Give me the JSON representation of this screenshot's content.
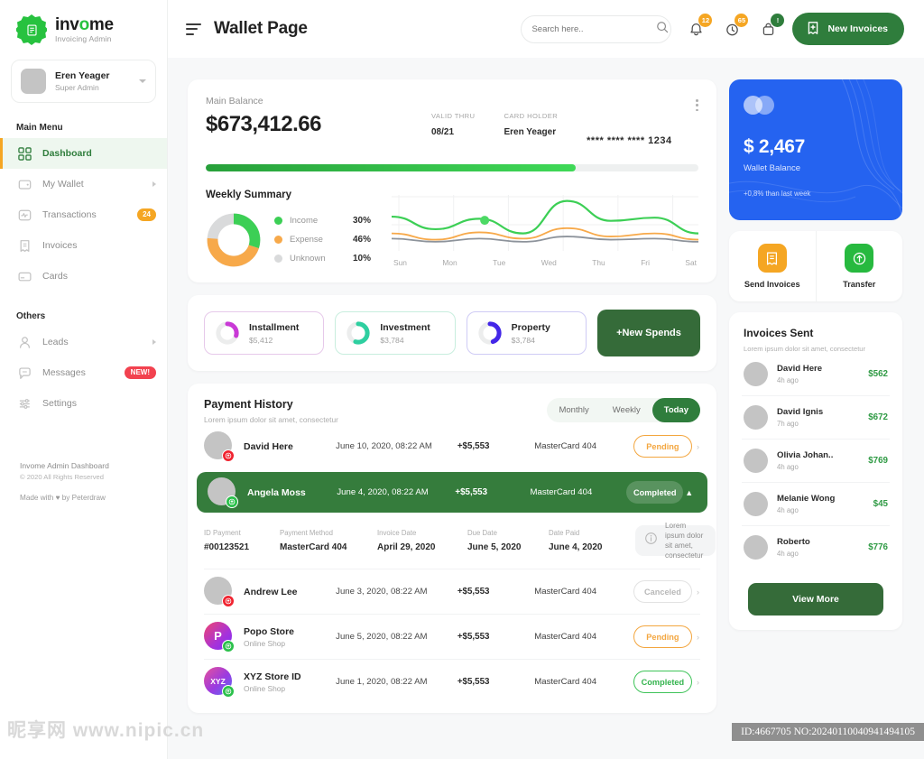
{
  "brand": {
    "name_pre": "inv",
    "name_mid": "o",
    "name_post": "me",
    "full": "invome",
    "subtitle": "Invoicing Admin"
  },
  "user": {
    "name": "Eren Yeager",
    "role": "Super Admin"
  },
  "sidebar": {
    "main_label": "Main Menu",
    "others_label": "Others",
    "main_items": [
      {
        "label": "Dashboard",
        "icon": "grid-icon",
        "badge": "",
        "arrow": false
      },
      {
        "label": "My Wallet",
        "icon": "wallet-icon",
        "badge": "",
        "arrow": true
      },
      {
        "label": "Transactions",
        "icon": "activity-icon",
        "badge": "24",
        "arrow": false
      },
      {
        "label": "Invoices",
        "icon": "invoice-icon",
        "badge": "",
        "arrow": false
      },
      {
        "label": "Cards",
        "icon": "card-icon",
        "badge": "",
        "arrow": false
      }
    ],
    "other_items": [
      {
        "label": "Leads",
        "icon": "user-icon",
        "badge": "",
        "arrow": true
      },
      {
        "label": "Messages",
        "icon": "chat-icon",
        "badge": "NEW!",
        "arrow": false
      },
      {
        "label": "Settings",
        "icon": "sliders-icon",
        "badge": "",
        "arrow": false
      }
    ],
    "footer": {
      "line1": "Invome Admin Dashboard",
      "line2": "© 2020 All Rights Reserved",
      "line3": "Made with ♥ by Peterdraw"
    }
  },
  "topbar": {
    "title": "Wallet Page",
    "search_placeholder": "Search here..",
    "notifications": [
      {
        "icon": "bell-icon",
        "count": "12",
        "color": "#f5a623"
      },
      {
        "icon": "clock-icon",
        "count": "65",
        "color": "#f5a623"
      },
      {
        "icon": "bag-icon",
        "count": "!",
        "color": "#2f7d3c"
      }
    ],
    "new_invoice_label": "New Invoices"
  },
  "balance": {
    "label": "Main Balance",
    "amount": "$673,412.66",
    "valid_thru_label": "VALID THRU",
    "valid_thru": "08/21",
    "card_holder_label": "CARD HOLDER",
    "card_holder": "Eren Yeager",
    "card_number": "**** **** **** 1234",
    "progress_percent": 75
  },
  "weekly": {
    "title": "Weekly Summary",
    "legend": [
      {
        "name": "Income",
        "value": "30%",
        "color": "#3ccf55"
      },
      {
        "name": "Expense",
        "value": "46%",
        "color": "#f7a94a"
      },
      {
        "name": "Unknown",
        "value": "10%",
        "color": "#d9dadb"
      }
    ]
  },
  "chart_data": {
    "type": "line",
    "title": "Weekly Summary",
    "x": [
      "Sun",
      "Mon",
      "Tue",
      "Wed",
      "Thu",
      "Fri",
      "Sat"
    ],
    "xlabel": "",
    "ylabel": "",
    "ylim": [
      0,
      100
    ],
    "grid": true,
    "legend_position": "left",
    "series": [
      {
        "name": "Income",
        "color": "#3ccf55",
        "values": [
          62,
          38,
          58,
          30,
          92,
          54,
          60,
          30
        ]
      },
      {
        "name": "Expense",
        "color": "#f7a94a",
        "values": [
          30,
          18,
          32,
          20,
          40,
          24,
          30,
          18
        ]
      },
      {
        "name": "Unknown",
        "color": "#8d939b",
        "values": [
          20,
          14,
          20,
          14,
          24,
          18,
          20,
          14
        ]
      }
    ],
    "highlight_point": {
      "series": "Income",
      "x": "Tue",
      "value": 55
    },
    "donut": {
      "type": "pie",
      "labels": [
        "Income",
        "Expense",
        "Unknown"
      ],
      "values": [
        30,
        46,
        10
      ],
      "colors": [
        "#3ccf55",
        "#f7a94a",
        "#d9dadb"
      ]
    }
  },
  "spends": {
    "tiles": [
      {
        "name": "Installment",
        "amount": "$5,412",
        "color": "#c93ad6",
        "border": "#e6c9ea",
        "ring_percent": 30
      },
      {
        "name": "Investment",
        "amount": "$3,784",
        "color": "#2ecfa0",
        "border": "#c8eede",
        "ring_percent": 55
      },
      {
        "name": "Property",
        "amount": "$3,784",
        "color": "#4326e8",
        "border": "#cfcbf5",
        "ring_percent": 45
      }
    ],
    "new_label": "+New Spends"
  },
  "history": {
    "title": "Payment History",
    "subtitle": "Lorem ipsum dolor sit amet, consectetur",
    "segments": [
      {
        "label": "Monthly",
        "active": false
      },
      {
        "label": "Weekly",
        "active": false
      },
      {
        "label": "Today",
        "active": true
      }
    ],
    "rows": [
      {
        "name": "David Here",
        "sub": "",
        "date": "June 10, 2020, 08:22 AM",
        "amount": "+$5,553",
        "card": "MasterCard 404",
        "status": "Pending",
        "status_type": "pending",
        "avatar": "plain",
        "dot": "red",
        "selected": false
      },
      {
        "name": "Angela Moss",
        "sub": "",
        "date": "June 4, 2020, 08:22 AM",
        "amount": "+$5,553",
        "card": "MasterCard 404",
        "status": "Completed",
        "status_type": "on-green",
        "avatar": "plain",
        "dot": "green",
        "selected": true
      },
      {
        "name": "Andrew Lee",
        "sub": "",
        "date": "June 3, 2020, 08:22 AM",
        "amount": "+$5,553",
        "card": "MasterCard 404",
        "status": "Canceled",
        "status_type": "canceled",
        "avatar": "plain",
        "dot": "red",
        "selected": false
      },
      {
        "name": "Popo Store",
        "sub": "Online Shop",
        "date": "June 5, 2020, 08:22 AM",
        "amount": "+$5,553",
        "card": "MasterCard 404",
        "status": "Pending",
        "status_type": "pending",
        "avatar": "grad-p",
        "avatar_text": "P",
        "dot": "green",
        "selected": false
      },
      {
        "name": "XYZ Store ID",
        "sub": "Online Shop",
        "date": "June 1, 2020, 08:22 AM",
        "amount": "+$5,553",
        "card": "MasterCard 404",
        "status": "Completed",
        "status_type": "completed",
        "avatar": "grad-x",
        "avatar_text": "XYZ",
        "dot": "green",
        "selected": false
      }
    ],
    "detail": {
      "fields": [
        {
          "label": "ID Payment",
          "value": "#00123521"
        },
        {
          "label": "Payment Method",
          "value": "MasterCard 404"
        },
        {
          "label": "Invoice Date",
          "value": "April 29, 2020"
        },
        {
          "label": "Due Date",
          "value": "June 5, 2020"
        },
        {
          "label": "Date Paid",
          "value": "June 4, 2020"
        }
      ],
      "note": "Lorem ipsum dolor sit amet, consectetur"
    }
  },
  "wallet_card": {
    "amount": "$ 2,467",
    "label": "Wallet Balance",
    "delta": "+0,8% than last week",
    "bg_color": "#2563f0"
  },
  "actions": [
    {
      "label": "Send Invoices",
      "icon": "invoice-send-icon",
      "color": "#f5a623"
    },
    {
      "label": "Transfer",
      "icon": "transfer-icon",
      "color": "#27b93f"
    }
  ],
  "invoices_sent": {
    "title": "Invoices Sent",
    "subtitle": "Lorem ipsum dolor sit amet, consectetur",
    "rows": [
      {
        "name": "David Here",
        "time": "4h ago",
        "amount": "$562"
      },
      {
        "name": "David Ignis",
        "time": "7h ago",
        "amount": "$672"
      },
      {
        "name": "Olivia Johan..",
        "time": "4h ago",
        "amount": "$769"
      },
      {
        "name": "Melanie Wong",
        "time": "4h ago",
        "amount": "$45"
      },
      {
        "name": "Roberto",
        "time": "4h ago",
        "amount": "$776"
      }
    ],
    "view_more_label": "View More"
  },
  "watermarks": {
    "left": "昵享网 www.nipic.cn",
    "right": "ID:4667705 NO:20240110040941494105"
  }
}
